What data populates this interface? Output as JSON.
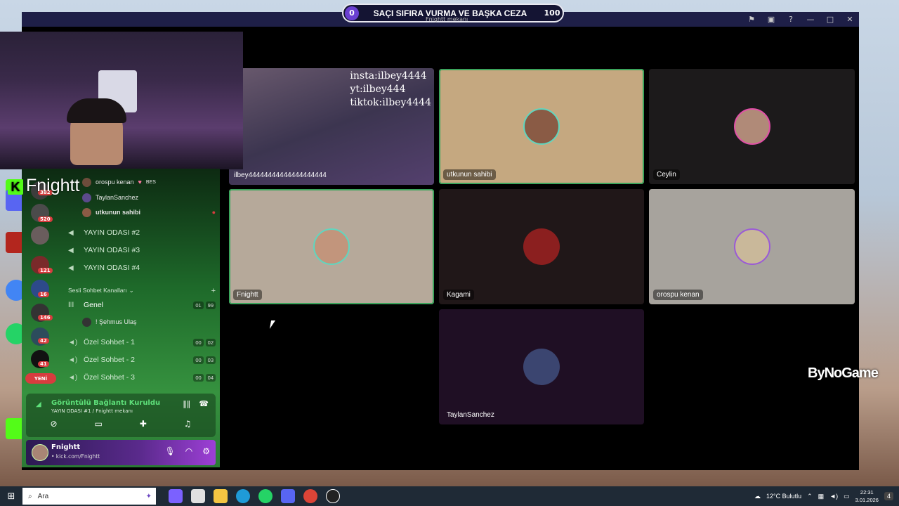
{
  "overlay": {
    "left_value": "0",
    "title": "SAÇI SIFIRA VURMA VE BAŞKA CEZA",
    "right_value": "100",
    "subtitle": "Fnightt mekanı"
  },
  "watermarks": {
    "left": "Fnightt",
    "right": "ByNoGame"
  },
  "stream_overlay_text": [
    "insta:ilbey4444",
    "yt:ilbey444",
    "tiktok:ilbey4444"
  ],
  "sidebar": {
    "voice_users_top": [
      {
        "name": "orospu kenan",
        "tag": "BES"
      },
      {
        "name": "TaylanSanchez"
      },
      {
        "name": "utkunun sahibi"
      }
    ],
    "channels_top": [
      {
        "label": "YAYIN ODASI #2"
      },
      {
        "label": "YAYIN ODASI #3"
      },
      {
        "label": "YAYIN ODASI #4"
      }
    ],
    "category": "Sesli Sohbet Kanalları",
    "voice_channels": [
      {
        "label": "Genel",
        "count_a": "01",
        "count_b": "99"
      },
      {
        "label": "Özel Sohbet - 1",
        "count_a": "00",
        "count_b": "02"
      },
      {
        "label": "Özel Sohbet - 2",
        "count_a": "00",
        "count_b": "03"
      },
      {
        "label": "Özel Sohbet - 3",
        "count_a": "00",
        "count_b": "04"
      }
    ],
    "genel_user": "! Şehmus Ulaş",
    "server_badges": [
      "382",
      "520",
      "121",
      "16",
      "146",
      "42",
      "41"
    ],
    "new_badge": "YENİ"
  },
  "voice_panel": {
    "status": "Görüntülü Bağlantı Kuruldu",
    "subtitle": "YAYIN ODASI #1 / Fnightt mekanı"
  },
  "user_panel": {
    "name": "Fnightt",
    "status": "• kick.com/Fnightt"
  },
  "tiles": {
    "stream": "ilbey44444444444444444444",
    "t1": "utkunun sahibi",
    "t2": "Ceylin",
    "t3": "Fnightt",
    "t4": "Kagami",
    "t5": "orospu kenan",
    "t6": "TaylanSanchez"
  },
  "taskbar": {
    "search_placeholder": "Ara",
    "weather": "12°C  Bulutlu",
    "time": "22:31",
    "date": "3.01.2026",
    "notif": "4"
  },
  "colors": {
    "accent_green": "#3ba55c",
    "overlay_bg": "#141433",
    "badge_red": "#d83c3e"
  }
}
